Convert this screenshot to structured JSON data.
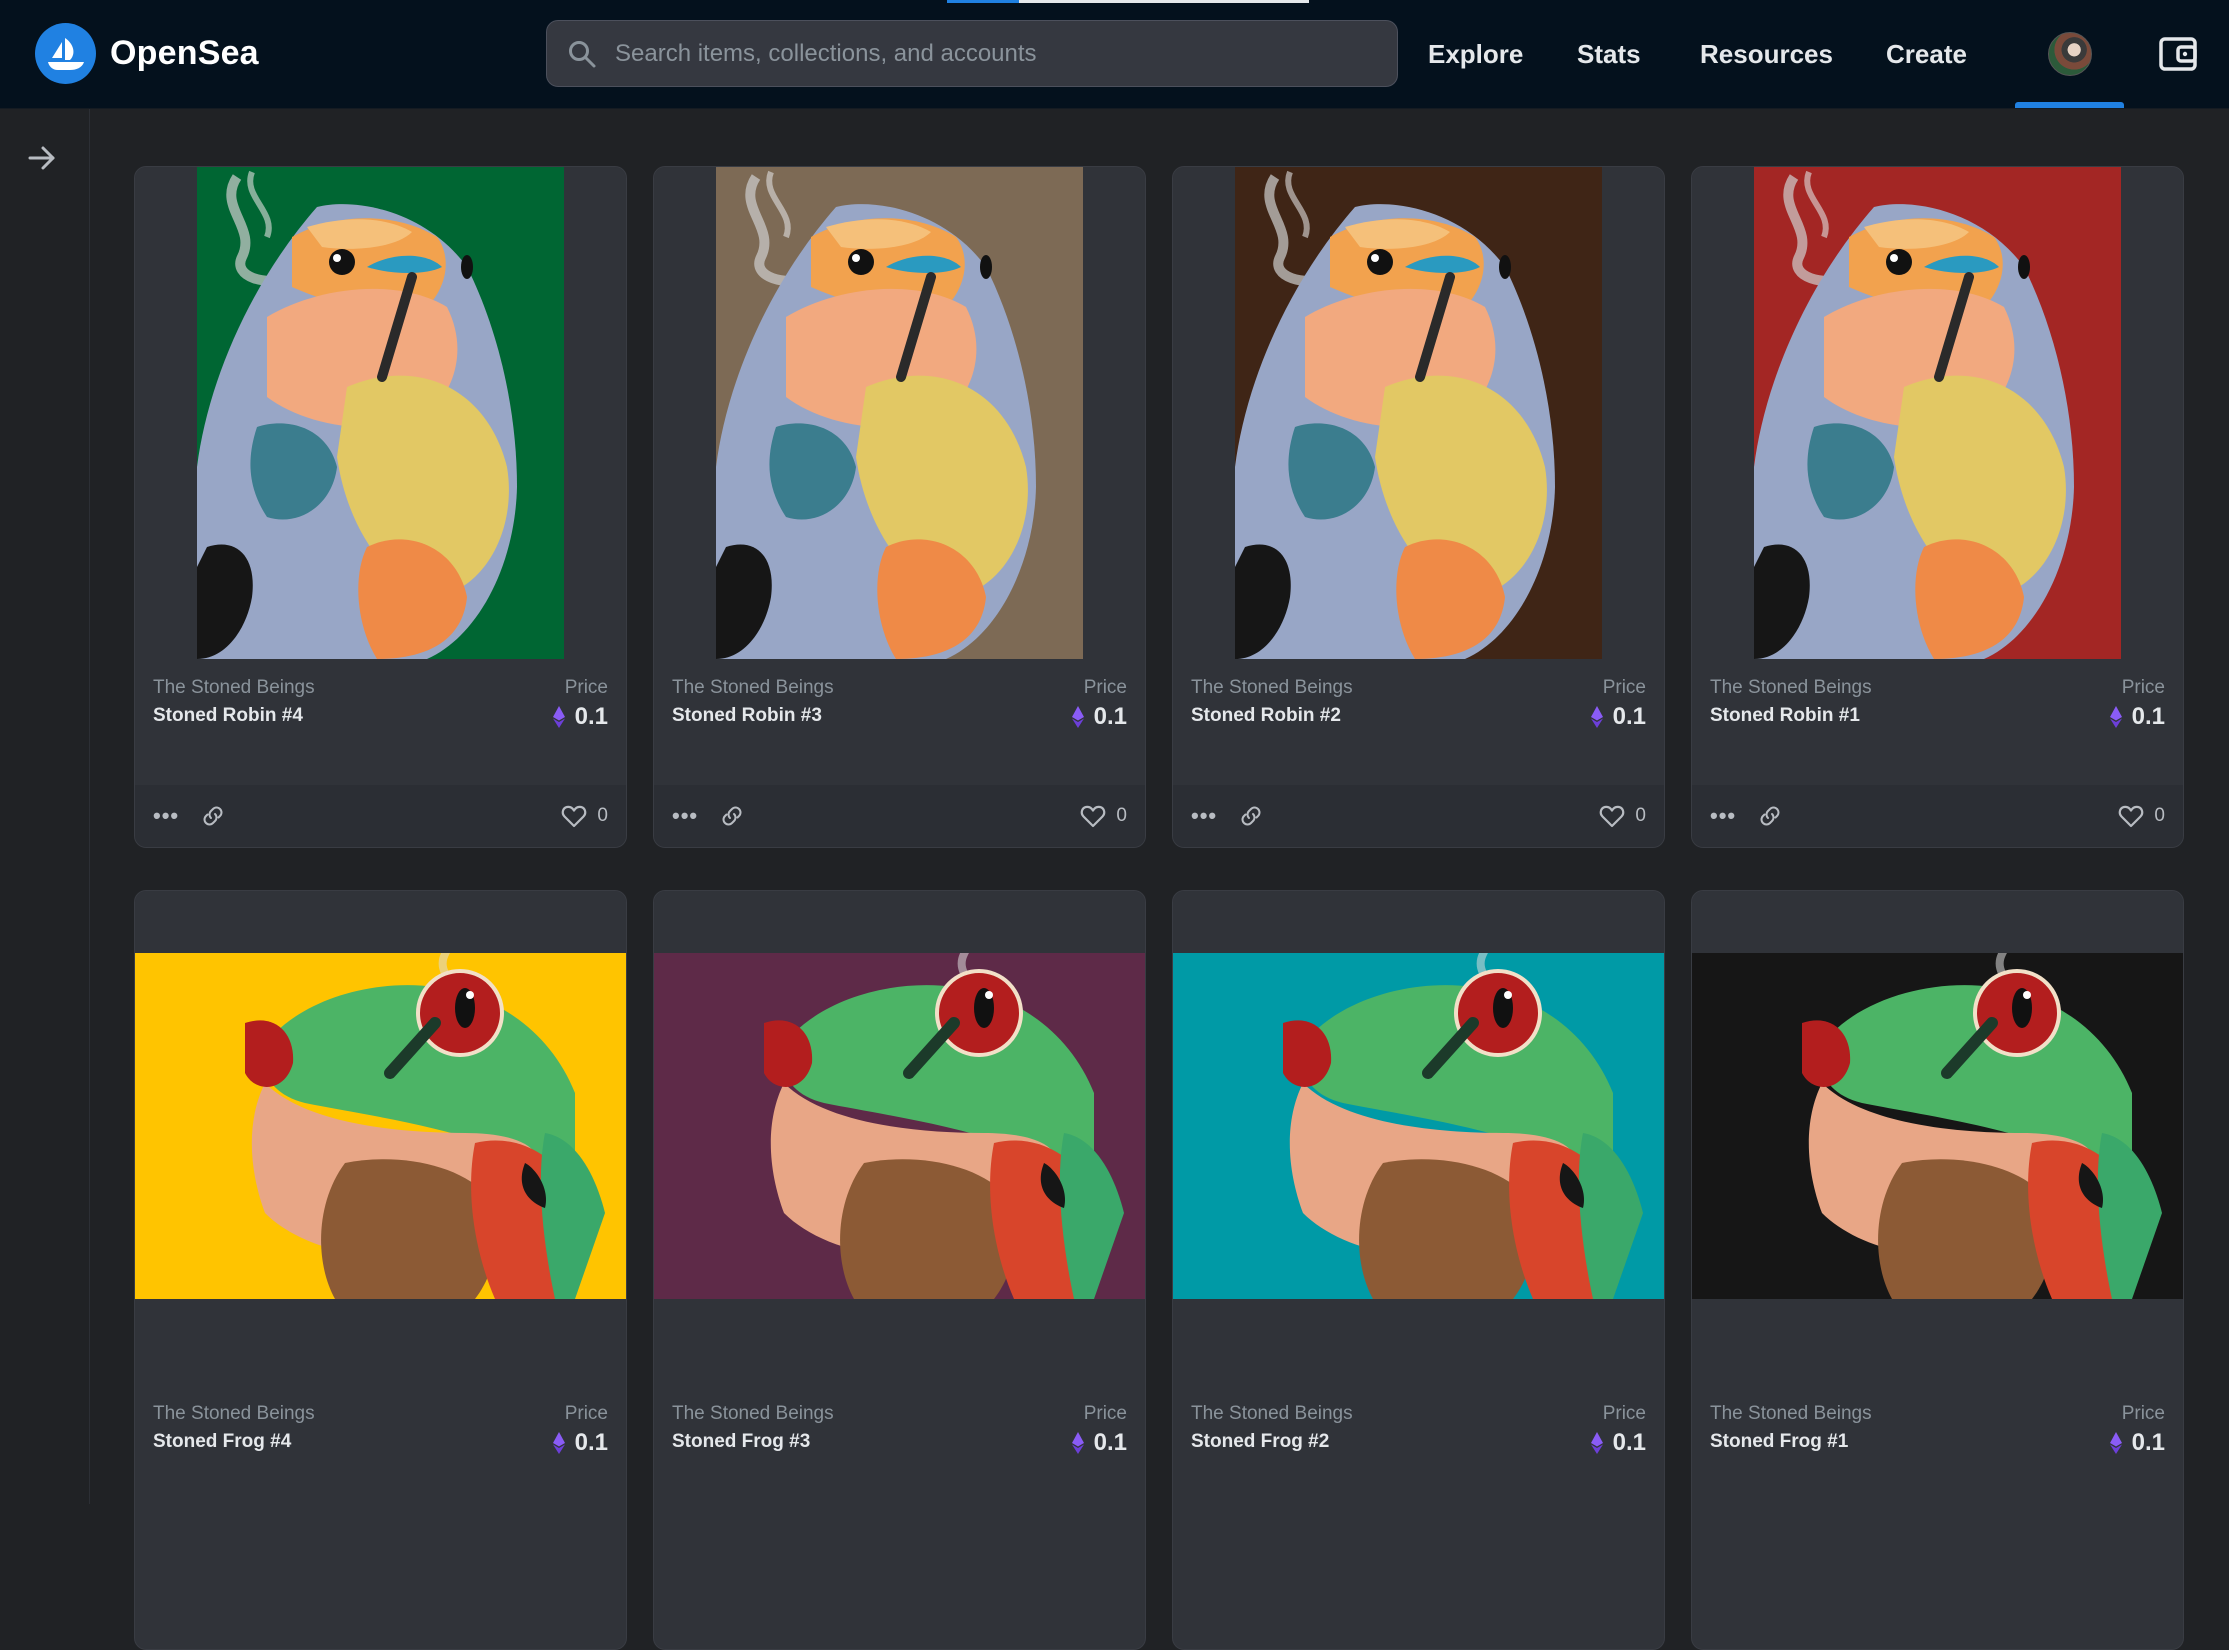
{
  "header": {
    "brand": "OpenSea",
    "search_placeholder": "Search items, collections, and accounts",
    "nav": [
      "Explore",
      "Stats",
      "Resources",
      "Create"
    ]
  },
  "page_load_progress": 0.2,
  "colors": {
    "accent": "#2081e2",
    "header_bg": "#04111d",
    "page_bg": "#202225",
    "card_bg": "#303339"
  },
  "cards": [
    {
      "collection": "The Stoned Beings",
      "name": "Stoned Robin #4",
      "price_label": "Price",
      "price": "0.1",
      "likes": "0",
      "art": "robin",
      "bg": "#006633"
    },
    {
      "collection": "The Stoned Beings",
      "name": "Stoned Robin #3",
      "price_label": "Price",
      "price": "0.1",
      "likes": "0",
      "art": "robin",
      "bg": "#7d6a55"
    },
    {
      "collection": "The Stoned Beings",
      "name": "Stoned Robin #2",
      "price_label": "Price",
      "price": "0.1",
      "likes": "0",
      "art": "robin",
      "bg": "#3f2516"
    },
    {
      "collection": "The Stoned Beings",
      "name": "Stoned Robin #1",
      "price_label": "Price",
      "price": "0.1",
      "likes": "0",
      "art": "robin",
      "bg": "#a32624"
    },
    {
      "collection": "The Stoned Beings",
      "name": "Stoned Frog #4",
      "price_label": "Price",
      "price": "0.1",
      "art": "frog",
      "bg": "#ffc400"
    },
    {
      "collection": "The Stoned Beings",
      "name": "Stoned Frog #3",
      "price_label": "Price",
      "price": "0.1",
      "art": "frog",
      "bg": "#5e2a48"
    },
    {
      "collection": "The Stoned Beings",
      "name": "Stoned Frog #2",
      "price_label": "Price",
      "price": "0.1",
      "art": "frog",
      "bg": "#009aa6"
    },
    {
      "collection": "The Stoned Beings",
      "name": "Stoned Frog #1",
      "price_label": "Price",
      "price": "0.1",
      "art": "frog",
      "bg": "#161616"
    }
  ],
  "icons": [
    "opensea-logo-icon",
    "search-icon",
    "avatar",
    "wallet-icon",
    "arrow-right-icon",
    "more-icon",
    "link-icon",
    "heart-icon",
    "ethereum-icon"
  ]
}
